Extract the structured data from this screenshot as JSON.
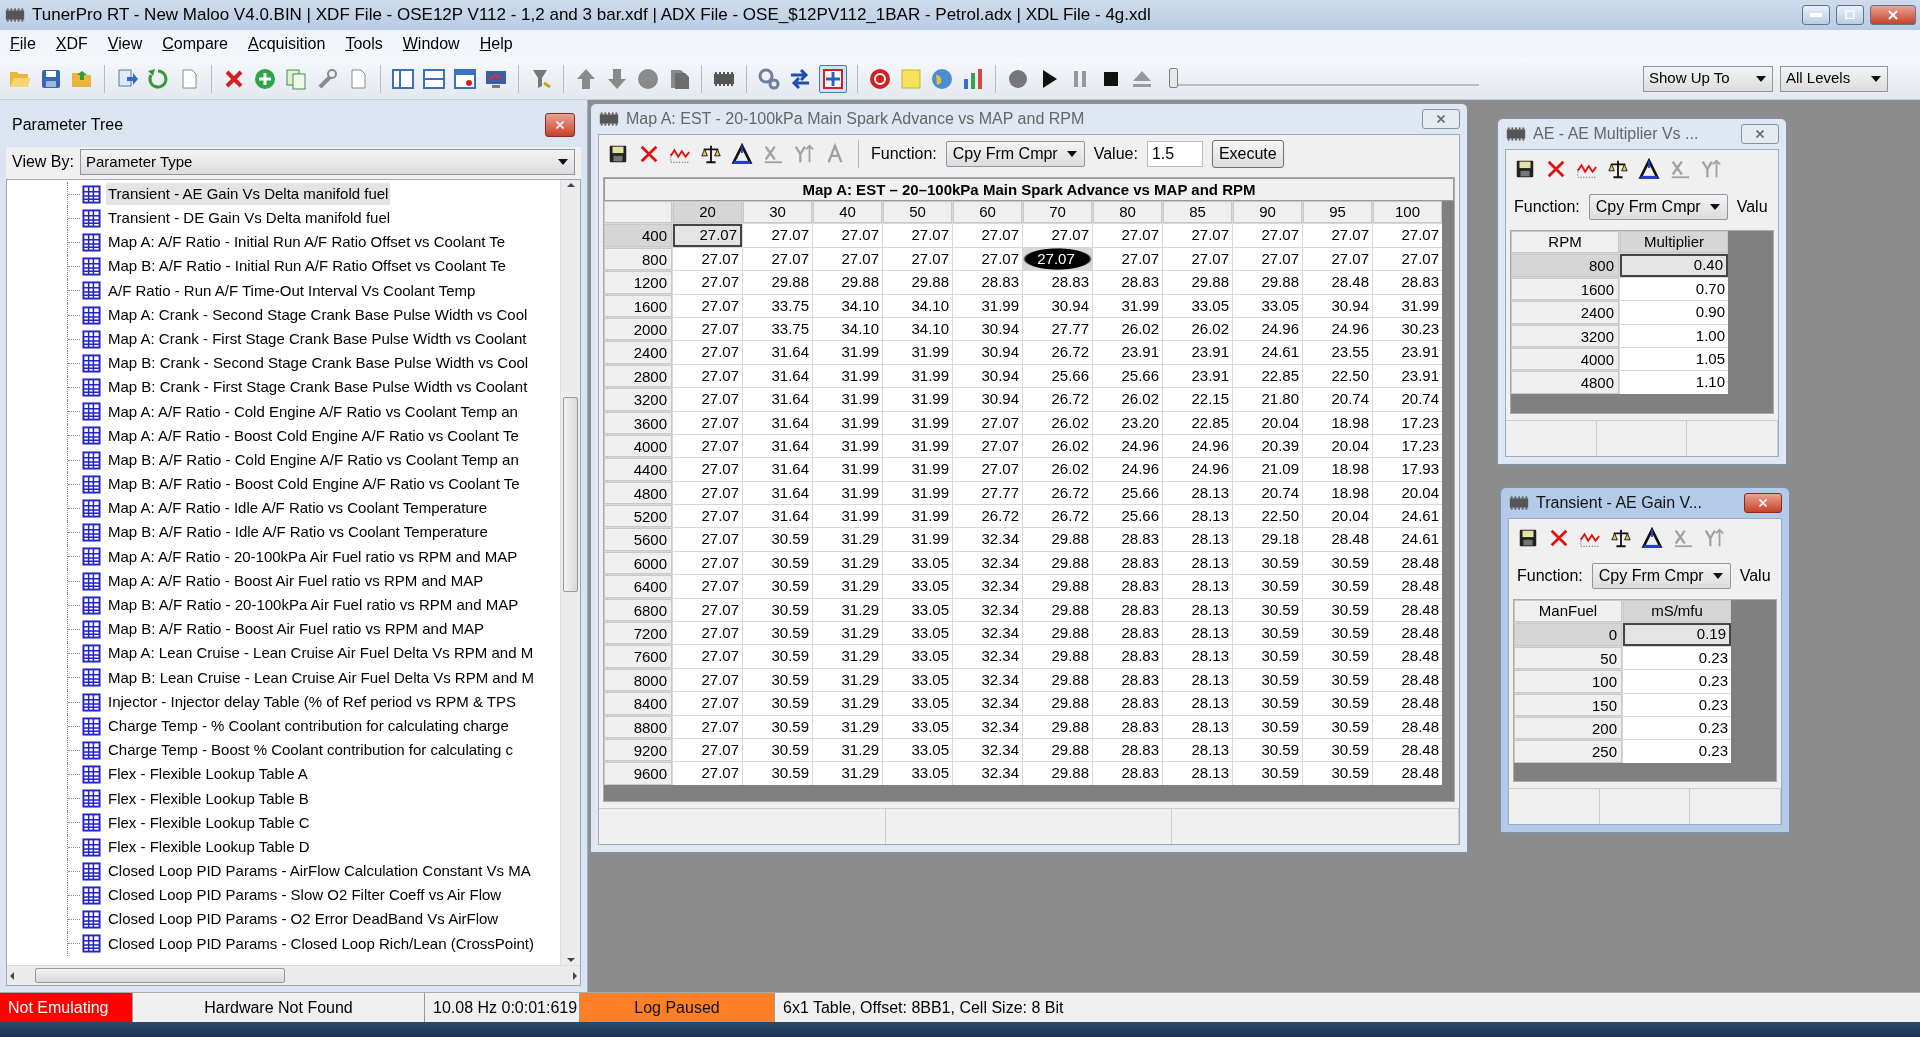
{
  "window": {
    "title": "TunerPro RT - New Maloo V4.0.BIN | XDF File - OSE12P V112 - 1,2 and 3 bar.xdf | ADX File - OSE_$12PV112_1BAR - Petrol.adx | XDL File - 4g.xdl"
  },
  "menu": [
    "File",
    "XDF",
    "View",
    "Compare",
    "Acquisition",
    "Tools",
    "Window",
    "Help"
  ],
  "toolbar": {
    "emulation_toggle": {
      "pressed": true
    },
    "slider": {
      "level": 0
    },
    "dropdowns": [
      "Show Up To",
      "All Levels"
    ]
  },
  "parameter_tree": {
    "title": "Parameter Tree",
    "view_by_label": "View By:",
    "view_by": "Parameter Type",
    "items": [
      {
        "label": "Transient - AE Gain Vs Delta manifold fuel",
        "selected": true
      },
      {
        "label": "Transient - DE Gain Vs Delta manifold fuel",
        "selected": false
      },
      {
        "label": "Map A: A/F Ratio - Initial Run A/F Ratio Offset vs Coolant Te",
        "selected": false
      },
      {
        "label": "Map B: A/F Ratio - Initial Run A/F Ratio Offset vs Coolant Te",
        "selected": false
      },
      {
        "label": "A/F Ratio - Run A/F Time-Out Interval Vs Coolant Temp",
        "selected": false
      },
      {
        "label": "Map A: Crank - Second Stage Crank Base Pulse Width vs Cool",
        "selected": false
      },
      {
        "label": "Map A: Crank - First Stage Crank Base Pulse Width vs Coolant",
        "selected": false
      },
      {
        "label": "Map B: Crank - Second Stage Crank Base Pulse Width vs Cool",
        "selected": false
      },
      {
        "label": "Map B: Crank - First Stage Crank Base Pulse Width vs Coolant",
        "selected": false
      },
      {
        "label": "Map A: A/F Ratio - Cold Engine A/F Ratio vs Coolant Temp an",
        "selected": false
      },
      {
        "label": "Map A: A/F Ratio - Boost Cold Engine A/F Ratio vs Coolant Te",
        "selected": false
      },
      {
        "label": "Map B: A/F Ratio - Cold Engine A/F Ratio vs Coolant Temp an",
        "selected": false
      },
      {
        "label": "Map B: A/F Ratio - Boost Cold Engine A/F Ratio vs Coolant Te",
        "selected": false
      },
      {
        "label": "Map A: A/F Ratio - Idle A/F Ratio vs Coolant Temperature",
        "selected": false
      },
      {
        "label": "Map B: A/F Ratio - Idle A/F Ratio vs Coolant Temperature",
        "selected": false
      },
      {
        "label": "Map A: A/F Ratio - 20-100kPa Air Fuel ratio vs RPM and MAP",
        "selected": false
      },
      {
        "label": "Map A: A/F Ratio - Boost Air Fuel ratio vs RPM and MAP",
        "selected": false
      },
      {
        "label": "Map B: A/F Ratio - 20-100kPa Air Fuel ratio vs RPM and MAP",
        "selected": false
      },
      {
        "label": "Map B: A/F Ratio - Boost Air Fuel ratio vs RPM and MAP",
        "selected": false
      },
      {
        "label": "Map A: Lean Cruise - Lean Cruise Air Fuel Delta Vs RPM and M",
        "selected": false
      },
      {
        "label": "Map B: Lean Cruise - Lean Cruise Air Fuel Delta Vs RPM and M",
        "selected": false
      },
      {
        "label": "Injector - Injector delay Table (% of Ref period vs RPM & TPS",
        "selected": false
      },
      {
        "label": "Charge Temp - % Coolant contribution for calculating charge",
        "selected": false
      },
      {
        "label": "Charge Temp - Boost % Coolant contribution for calculating c",
        "selected": false
      },
      {
        "label": "Flex - Flexible Lookup Table A",
        "selected": false
      },
      {
        "label": "Flex - Flexible Lookup Table B",
        "selected": false
      },
      {
        "label": "Flex - Flexible Lookup Table C",
        "selected": false
      },
      {
        "label": "Flex - Flexible Lookup Table D",
        "selected": false
      },
      {
        "label": "Closed Loop PID Params - AirFlow Calculation Constant Vs MA",
        "selected": false
      },
      {
        "label": "Closed Loop PID Params - Slow O2 Filter Coeff vs Air Flow",
        "selected": false
      },
      {
        "label": "Closed Loop PID Params - O2 Error DeadBand Vs AirFlow",
        "selected": false
      },
      {
        "label": "Closed Loop PID Params - Closed Loop Rich/Lean (CrossPoint)",
        "selected": false
      }
    ]
  },
  "map_windows": [
    {
      "title": "Map A: EST - 20-100kPa Main Spark Advance vs MAP and RPM",
      "active": false,
      "tools": [
        {
          "kind": "save",
          "disabled": false
        },
        {
          "kind": "delete",
          "disabled": false
        },
        {
          "kind": "graph",
          "disabled": false
        },
        {
          "kind": "scale",
          "disabled": false
        },
        {
          "kind": "compare",
          "disabled": false
        },
        {
          "kind": "xaxis",
          "disabled": true
        },
        {
          "kind": "yaxis",
          "disabled": true
        },
        {
          "kind": "text",
          "disabled": true
        }
      ],
      "function_label": "Function:",
      "function": "Cpy Frm Cmpr",
      "value_label": "Value:",
      "value": "1.5",
      "execute": "Execute",
      "table": {
        "title": "Map A: EST – 20–100kPa Main Spark Advance vs MAP and RPM",
        "columns": [
          "20",
          "30",
          "40",
          "50",
          "60",
          "70",
          "80",
          "85",
          "90",
          "95",
          "100"
        ],
        "rows": [
          {
            "label": "400",
            "values": [
              {
                "value": "27.07",
                "cursor": true
              },
              "27.07",
              "27.07",
              "27.07",
              "27.07",
              "27.07",
              "27.07",
              "27.07",
              "27.07",
              "27.07",
              "27.07"
            ]
          },
          {
            "label": "800",
            "values": [
              "27.07",
              "27.07",
              "27.07",
              "27.07",
              "27.07",
              {
                "value": "27.07",
                "trace": true
              },
              "27.07",
              "27.07",
              "27.07",
              "27.07",
              "27.07"
            ]
          },
          {
            "label": "1200",
            "values": [
              "27.07",
              "29.88",
              "29.88",
              "29.88",
              "28.83",
              "28.83",
              "28.83",
              "29.88",
              "29.88",
              "28.48",
              "28.83"
            ]
          },
          {
            "label": "1600",
            "values": [
              "27.07",
              "33.75",
              "34.10",
              "34.10",
              "31.99",
              "30.94",
              "31.99",
              "33.05",
              "33.05",
              "30.94",
              "31.99"
            ]
          },
          {
            "label": "2000",
            "values": [
              "27.07",
              "33.75",
              "34.10",
              "34.10",
              "30.94",
              "27.77",
              "26.02",
              "26.02",
              "24.96",
              "24.96",
              "30.23"
            ]
          },
          {
            "label": "2400",
            "values": [
              "27.07",
              "31.64",
              "31.99",
              "31.99",
              "30.94",
              "26.72",
              "23.91",
              "23.91",
              "24.61",
              "23.55",
              "23.91"
            ]
          },
          {
            "label": "2800",
            "values": [
              "27.07",
              "31.64",
              "31.99",
              "31.99",
              "30.94",
              "25.66",
              "25.66",
              "23.91",
              "22.85",
              "22.50",
              "23.91"
            ]
          },
          {
            "label": "3200",
            "values": [
              "27.07",
              "31.64",
              "31.99",
              "31.99",
              "30.94",
              "26.72",
              "26.02",
              "22.15",
              "21.80",
              "20.74",
              "20.74"
            ]
          },
          {
            "label": "3600",
            "values": [
              "27.07",
              "31.64",
              "31.99",
              "31.99",
              "27.07",
              "26.02",
              "23.20",
              "22.85",
              "20.04",
              "18.98",
              "17.23"
            ]
          },
          {
            "label": "4000",
            "values": [
              "27.07",
              "31.64",
              "31.99",
              "31.99",
              "27.07",
              "26.02",
              "24.96",
              "24.96",
              "20.39",
              "20.04",
              "17.23"
            ]
          },
          {
            "label": "4400",
            "values": [
              "27.07",
              "31.64",
              "31.99",
              "31.99",
              "27.07",
              "26.02",
              "24.96",
              "24.96",
              "21.09",
              "18.98",
              "17.93"
            ]
          },
          {
            "label": "4800",
            "values": [
              "27.07",
              "31.64",
              "31.99",
              "31.99",
              "27.77",
              "26.72",
              "25.66",
              "28.13",
              "20.74",
              "18.98",
              "20.04"
            ]
          },
          {
            "label": "5200",
            "values": [
              "27.07",
              "31.64",
              "31.99",
              "31.99",
              "26.72",
              "26.72",
              "25.66",
              "28.13",
              "22.50",
              "20.04",
              "24.61"
            ]
          },
          {
            "label": "5600",
            "values": [
              "27.07",
              "30.59",
              "31.29",
              "31.99",
              "32.34",
              "29.88",
              "28.83",
              "28.13",
              "29.18",
              "28.48",
              "24.61"
            ]
          },
          {
            "label": "6000",
            "values": [
              "27.07",
              "30.59",
              "31.29",
              "33.05",
              "32.34",
              "29.88",
              "28.83",
              "28.13",
              "30.59",
              "30.59",
              "28.48"
            ]
          },
          {
            "label": "6400",
            "values": [
              "27.07",
              "30.59",
              "31.29",
              "33.05",
              "32.34",
              "29.88",
              "28.83",
              "28.13",
              "30.59",
              "30.59",
              "28.48"
            ]
          },
          {
            "label": "6800",
            "values": [
              "27.07",
              "30.59",
              "31.29",
              "33.05",
              "32.34",
              "29.88",
              "28.83",
              "28.13",
              "30.59",
              "30.59",
              "28.48"
            ]
          },
          {
            "label": "7200",
            "values": [
              "27.07",
              "30.59",
              "31.29",
              "33.05",
              "32.34",
              "29.88",
              "28.83",
              "28.13",
              "30.59",
              "30.59",
              "28.48"
            ]
          },
          {
            "label": "7600",
            "values": [
              "27.07",
              "30.59",
              "31.29",
              "33.05",
              "32.34",
              "29.88",
              "28.83",
              "28.13",
              "30.59",
              "30.59",
              "28.48"
            ]
          },
          {
            "label": "8000",
            "values": [
              "27.07",
              "30.59",
              "31.29",
              "33.05",
              "32.34",
              "29.88",
              "28.83",
              "28.13",
              "30.59",
              "30.59",
              "28.48"
            ]
          },
          {
            "label": "8400",
            "values": [
              "27.07",
              "30.59",
              "31.29",
              "33.05",
              "32.34",
              "29.88",
              "28.83",
              "28.13",
              "30.59",
              "30.59",
              "28.48"
            ]
          },
          {
            "label": "8800",
            "values": [
              "27.07",
              "30.59",
              "31.29",
              "33.05",
              "32.34",
              "29.88",
              "28.83",
              "28.13",
              "30.59",
              "30.59",
              "28.48"
            ]
          },
          {
            "label": "9200",
            "values": [
              "27.07",
              "30.59",
              "31.29",
              "33.05",
              "32.34",
              "29.88",
              "28.83",
              "28.13",
              "30.59",
              "30.59",
              "28.48"
            ]
          },
          {
            "label": "9600",
            "values": [
              "27.07",
              "30.59",
              "31.29",
              "33.05",
              "32.34",
              "29.88",
              "28.83",
              "28.13",
              "30.59",
              "30.59",
              "28.48"
            ]
          }
        ]
      }
    },
    {
      "title": "AE - AE Multiplier Vs ...",
      "active": false,
      "tools": [
        {
          "kind": "save",
          "disabled": false
        },
        {
          "kind": "delete",
          "disabled": false
        },
        {
          "kind": "graph",
          "disabled": false
        },
        {
          "kind": "scale",
          "disabled": false
        },
        {
          "kind": "compare",
          "disabled": false
        },
        {
          "kind": "xaxis",
          "disabled": true
        },
        {
          "kind": "yaxis",
          "disabled": true
        }
      ],
      "function_label": "Function:",
      "function": "Cpy Frm Cmpr",
      "value_label": "Valu",
      "table": {
        "row_header": "RPM",
        "columns": [
          "Multiplier"
        ],
        "rows": [
          {
            "label": "800",
            "values": [
              {
                "value": "0.40",
                "cursor": true
              }
            ]
          },
          {
            "label": "1600",
            "values": [
              "0.70"
            ]
          },
          {
            "label": "2400",
            "values": [
              "0.90"
            ]
          },
          {
            "label": "3200",
            "values": [
              "1.00"
            ]
          },
          {
            "label": "4000",
            "values": [
              "1.05"
            ]
          },
          {
            "label": "4800",
            "values": [
              "1.10"
            ]
          }
        ]
      }
    },
    {
      "title": "Transient - AE Gain V...",
      "active": true,
      "tools": [
        {
          "kind": "save",
          "disabled": false
        },
        {
          "kind": "delete",
          "disabled": false
        },
        {
          "kind": "graph",
          "disabled": false
        },
        {
          "kind": "scale",
          "disabled": false
        },
        {
          "kind": "compare",
          "disabled": false
        },
        {
          "kind": "xaxis",
          "disabled": true
        },
        {
          "kind": "yaxis",
          "disabled": true
        }
      ],
      "function_label": "Function:",
      "function": "Cpy Frm Cmpr",
      "value_label": "Valu",
      "table": {
        "row_header": "ManFuel",
        "columns": [
          "mS/mfu"
        ],
        "rows": [
          {
            "label": "0",
            "values": [
              {
                "value": "0.19",
                "cursor": true
              }
            ]
          },
          {
            "label": "50",
            "values": [
              "0.23"
            ]
          },
          {
            "label": "100",
            "values": [
              "0.23"
            ]
          },
          {
            "label": "150",
            "values": [
              "0.23"
            ]
          },
          {
            "label": "200",
            "values": [
              "0.23"
            ]
          },
          {
            "label": "250",
            "values": [
              "0.23"
            ]
          }
        ]
      }
    }
  ],
  "status_bar": [
    {
      "text": "Not Emulating",
      "color": "#ff0000"
    },
    {
      "text": "Hardware Not Found"
    },
    {
      "text": "10.08 Hz  0:0:01:619"
    },
    {
      "text": "Log Paused",
      "color": "#ff7f27"
    },
    {
      "text": "6x1 Table, Offset: 8BB1,  Cell Size: 8 Bit"
    }
  ]
}
